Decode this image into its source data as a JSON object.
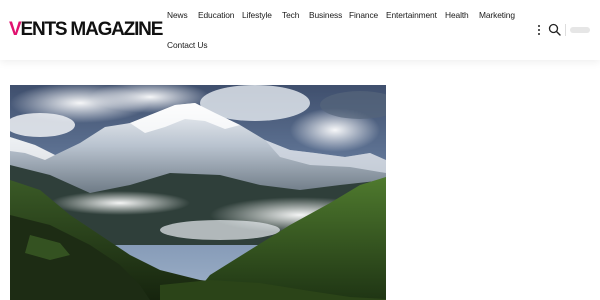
{
  "site": {
    "logo_first": "V",
    "logo_rest": "ENTS MAGAZINE",
    "brand_color": "#e0116f"
  },
  "nav": {
    "items": [
      {
        "label": "News"
      },
      {
        "label": "Education"
      },
      {
        "label": "Lifestyle"
      },
      {
        "label": "Tech"
      },
      {
        "label": "Business"
      },
      {
        "label": "Finance"
      },
      {
        "label": "Entertainment"
      },
      {
        "label": "Health"
      },
      {
        "label": "Marketing"
      },
      {
        "label": "Contact Us"
      }
    ]
  },
  "header_tools": {
    "more_icon": "vertical-dots-icon",
    "search_icon": "search-icon"
  },
  "featured": {
    "image": "mountain-landscape-photo"
  }
}
